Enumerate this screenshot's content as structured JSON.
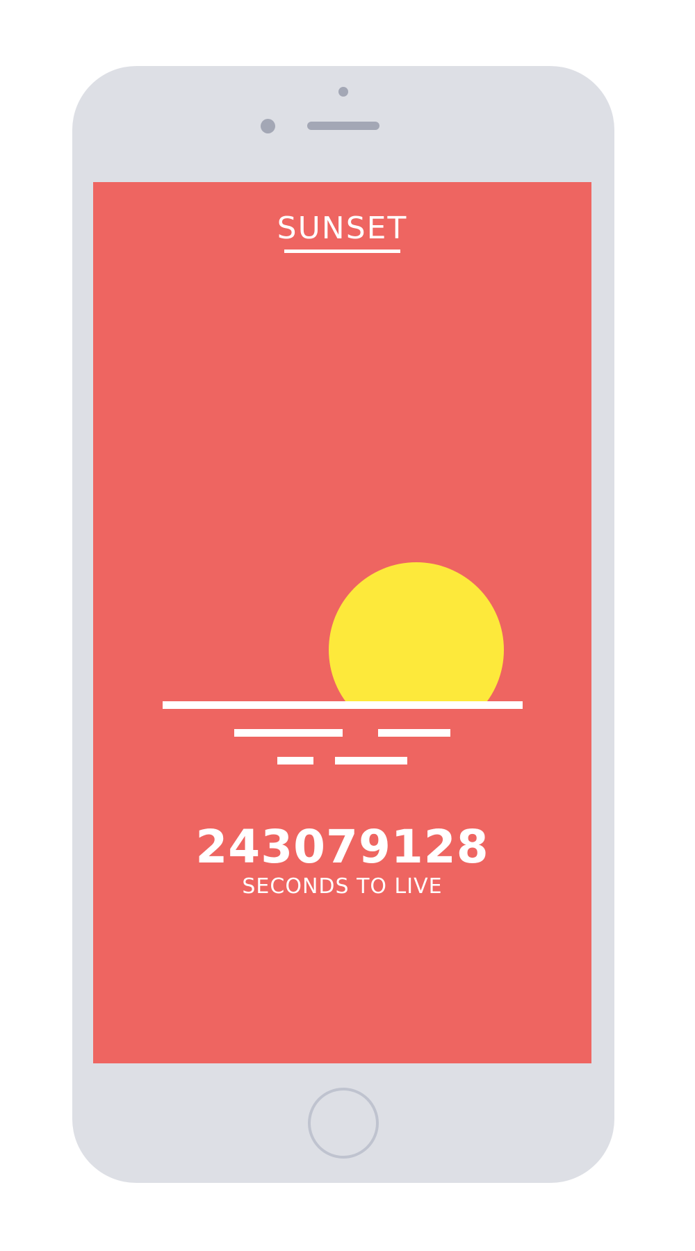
{
  "app": {
    "title": "SUNSET"
  },
  "countdown": {
    "value": "243079128",
    "caption": "SECONDS TO LIVE"
  },
  "colors": {
    "background": "#ee6561",
    "sun": "#fde93b",
    "text": "#ffffff",
    "device_body": "#dddfe5"
  },
  "icons": {
    "sun": "sun-circle",
    "horizon": "horizon-lines"
  }
}
